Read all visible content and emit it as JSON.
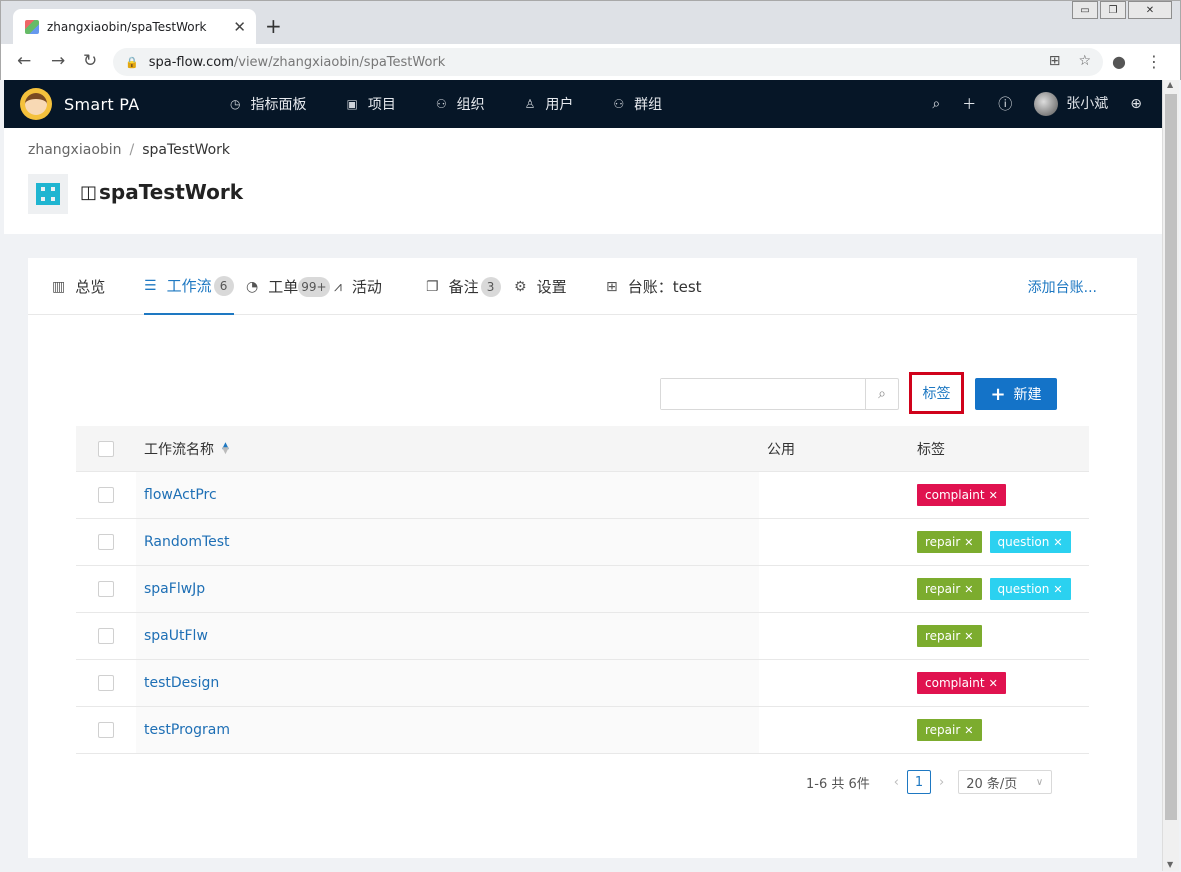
{
  "browser": {
    "tab_title": "zhangxiaobin/spaTestWork",
    "tab_close": "✕",
    "new_tab": "+",
    "url_host": "spa-flow.com",
    "url_path": "/view/zhangxiaobin/spaTestWork",
    "win_min": "▭",
    "win_max": "❐",
    "win_close": "✕"
  },
  "app": {
    "brand": "Smart PA",
    "menu": [
      {
        "label": "指标面板",
        "icon": "dashboard-icon"
      },
      {
        "label": "项目",
        "icon": "project-icon"
      },
      {
        "label": "组织",
        "icon": "organization-icon"
      },
      {
        "label": "用户",
        "icon": "user-icon"
      },
      {
        "label": "群组",
        "icon": "group-icon"
      }
    ],
    "user_name": "张小斌"
  },
  "breadcrumb": {
    "owner": "zhangxiaobin",
    "separator": "/",
    "project": "spaTestWork"
  },
  "project_title": "spaTestWork",
  "tabs": {
    "overview": "总览",
    "workflow": "工作流",
    "workflow_count": "6",
    "workorder": "工单",
    "workorder_count": "99+",
    "activity": "活动",
    "notes": "备注",
    "notes_count": "3",
    "settings": "设置",
    "ledger": "台账：test",
    "add_ledger": "添加台账..."
  },
  "toolbar": {
    "search_placeholder": "",
    "tag_label": "标签",
    "new_label": "新建"
  },
  "table": {
    "headers": {
      "name": "工作流名称",
      "public": "公用",
      "tags": "标签"
    },
    "rows": [
      {
        "name": "flowActPrc",
        "public": "",
        "tags": [
          {
            "label": "complaint",
            "kind": "complaint"
          }
        ]
      },
      {
        "name": "RandomTest",
        "public": "",
        "tags": [
          {
            "label": "repair",
            "kind": "repair"
          },
          {
            "label": "question",
            "kind": "question"
          }
        ]
      },
      {
        "name": "spaFlwJp",
        "public": "",
        "tags": [
          {
            "label": "repair",
            "kind": "repair"
          },
          {
            "label": "question",
            "kind": "question"
          }
        ]
      },
      {
        "name": "spaUtFlw",
        "public": "",
        "tags": [
          {
            "label": "repair",
            "kind": "repair"
          }
        ]
      },
      {
        "name": "testDesign",
        "public": "",
        "tags": [
          {
            "label": "complaint",
            "kind": "complaint"
          }
        ]
      },
      {
        "name": "testProgram",
        "public": "",
        "tags": [
          {
            "label": "repair",
            "kind": "repair"
          }
        ]
      }
    ]
  },
  "pagination": {
    "total_text": "1-6 共 6件",
    "current_page": "1",
    "page_size": "20 条/页"
  },
  "colors": {
    "header_bg": "#061627",
    "accent": "#1e78c2",
    "primary_button": "#1473c8",
    "highlight_border": "#d0021b",
    "tag_complaint": "#e0124f",
    "tag_repair": "#7cac2e",
    "tag_question": "#2bd1f0"
  }
}
